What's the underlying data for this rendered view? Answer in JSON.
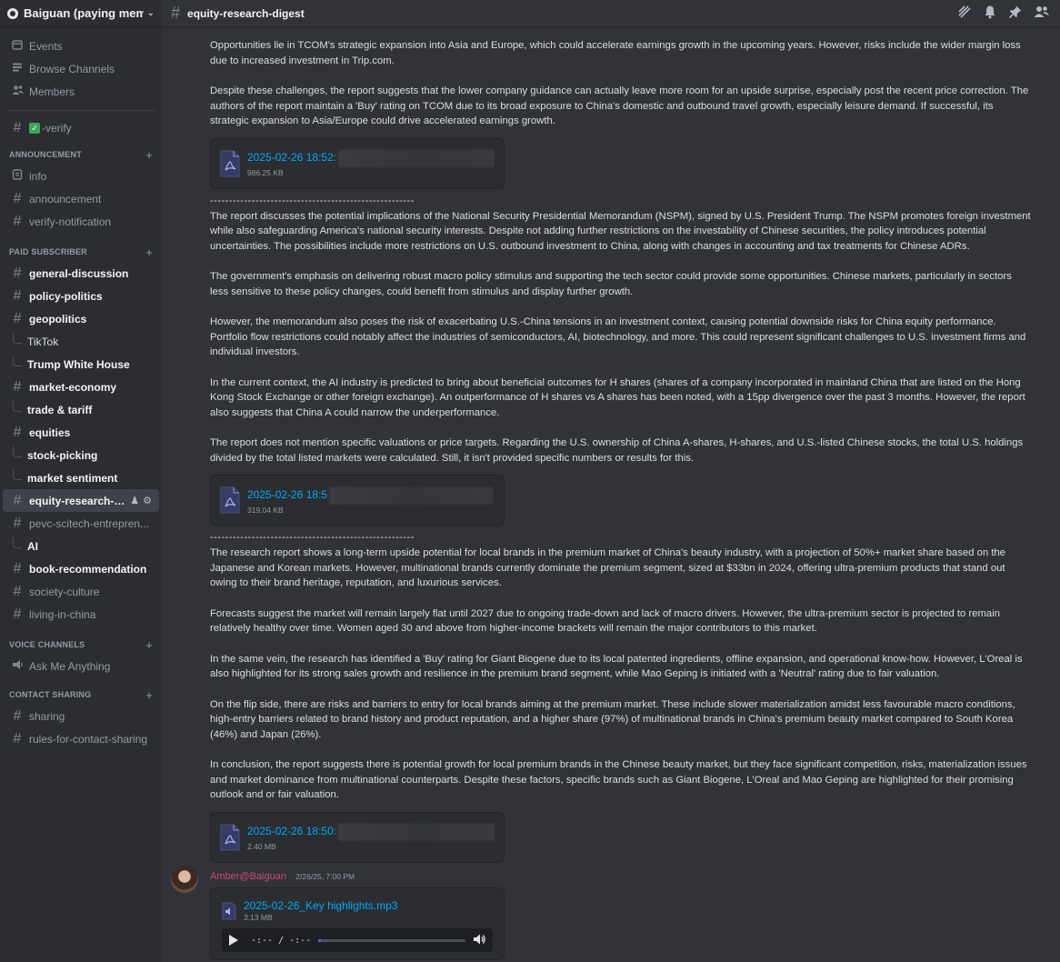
{
  "server": {
    "name": "Baiguan (paying mem..."
  },
  "sidebar": {
    "top_items": [
      {
        "label": "Events",
        "icon": "calendar-icon"
      },
      {
        "label": "Browse Channels",
        "icon": "list-icon"
      },
      {
        "label": "Members",
        "icon": "members-icon"
      }
    ],
    "verify": {
      "label": "-verify",
      "check": "✓"
    },
    "categories": {
      "announcement": "ANNOUNCEMENT",
      "paid": "PAID SUBSCRIBER",
      "voice": "VOICE CHANNELS",
      "contact": "CONTACT SHARING"
    },
    "announcement_channels": [
      "info",
      "announcement",
      "verify-notification"
    ],
    "paid": {
      "general": "general-discussion",
      "policy": "policy-politics",
      "geopolitics": "geopolitics",
      "tiktok": "TikTok",
      "trump": "Trump White House",
      "market": "market-economy",
      "trade": "trade & tariff",
      "equities": "equities",
      "stock": "stock-picking",
      "sentiment": "market sentiment",
      "equity_research": "equity-research-di...",
      "pevc": "pevc-scitech-entrepren...",
      "ai": "AI",
      "book": "book-recommendation",
      "society": "society-culture",
      "living": "living-in-china"
    },
    "voice_channel": "Ask Me Anything",
    "contact_channels": [
      "sharing",
      "rules-for-contact-sharing"
    ]
  },
  "channel": {
    "title": "equity-research-digest"
  },
  "messages": {
    "p1": "Opportunities lie in TCOM's strategic expansion into Asia and Europe, which could accelerate earnings growth in the upcoming years. However, risks include the wider margin loss due to increased investment in Trip.com.",
    "p2": "Despite these challenges, the report suggests that the lower company guidance can actually leave more room for an upside surprise, especially post the recent price correction. The authors of the report maintain a 'Buy' rating on TCOM due to its broad exposure to China's domestic and outbound travel growth, especially leisure demand. If successful, its strategic expansion to Asia/Europe could drive accelerated earnings growth.",
    "file1": {
      "name": "2025-02-26 18:52:",
      "size": "986.25 KB"
    },
    "divider": "------------------------------------------------------",
    "p3": "The report discusses the potential implications of the National Security Presidential Memorandum (NSPM), signed by U.S. President Trump. The NSPM promotes foreign investment while also safeguarding America's national security interests. Despite not adding further restrictions on the investability of Chinese securities, the policy introduces potential uncertainties. The possibilities include more restrictions on U.S. outbound investment to China, along with changes in accounting and tax treatments for Chinese ADRs.",
    "p4": "The government's emphasis on delivering robust macro policy stimulus and supporting the tech sector could provide some opportunities. Chinese markets, particularly in sectors less sensitive to these policy changes, could benefit from stimulus and display further growth.",
    "p5": "However, the memorandum also poses the risk of exacerbating U.S.-China tensions in an investment context, causing potential downside risks for China equity performance. Portfolio flow restrictions could notably affect the industries of semiconductors, AI, biotechnology, and more. This could represent significant challenges to U.S. investment firms and individual investors.",
    "p6": "In the current context, the AI industry is predicted to bring about beneficial outcomes for H shares (shares of a company incorporated in mainland China that are listed on the Hong Kong Stock Exchange or other foreign exchange). An outperformance of H shares vs A shares has been noted, with a 15pp divergence over the past 3 months. However, the report also suggests that China A could narrow the underperformance.",
    "p7": "The report does not mention specific valuations or price targets. Regarding the U.S. ownership of China A-shares, H-shares, and U.S.-listed Chinese stocks, the total U.S. holdings divided by the total listed markets were calculated. Still, it isn't provided specific numbers or results for this.",
    "file2": {
      "name": "2025-02-26 18:5",
      "size": "319.04 KB"
    },
    "p8": "The research report shows a long-term upside potential for local brands in the premium market of China's beauty industry, with a projection of 50%+ market share based on the Japanese and Korean markets. However, multinational brands currently dominate the premium segment, sized at $33bn in 2024, offering ultra-premium products that stand out owing to their brand heritage, reputation, and luxurious services.",
    "p9": "Forecasts suggest the market will remain largely flat until 2027 due to ongoing trade-down and lack of macro drivers. However, the ultra-premium sector is projected to remain relatively healthy over time. Women aged 30 and above from higher-income brackets will remain the major contributors to this market.",
    "p10": "In the same vein, the research has identified a 'Buy' rating for Giant Biogene due to its local patented ingredients, offline expansion, and operational know-how. However, L'Oreal is also highlighted for its strong sales growth and resilience in the premium brand segment, while Mao Geping is initiated with a 'Neutral' rating due to fair valuation.",
    "p11": "On the flip side, there are risks and barriers to entry for local brands aiming at the premium market. These include slower materialization amidst less favourable macro conditions, high-entry barriers related to brand history and product reputation, and a higher share (97%) of multinational brands in China's premium beauty market compared to South Korea (46%) and Japan (26%).",
    "p12": "In conclusion, the report suggests there is potential growth for local premium brands in the Chinese beauty market, but they face significant competition, risks, materialization issues and market dominance from multinational counterparts. Despite these factors, specific brands such as Giant Biogene, L'Oreal and Mao Geping are highlighted for their promising outlook and or fair valuation.",
    "file3": {
      "name": "2025-02-26 18:50:",
      "size": "2.40 MB"
    }
  },
  "author": {
    "name": "Amber@Baiguan",
    "timestamp": "2/26/25, 7:00 PM"
  },
  "audio": {
    "name": "2025-02-26_Key highlights.mp3",
    "size": "3.13 MB",
    "time": "-:-- / -:--",
    "progress": 0.02
  },
  "colors": {
    "accent_link": "#00a8fc",
    "author": "#c9497a",
    "active_bg": "#404249"
  }
}
